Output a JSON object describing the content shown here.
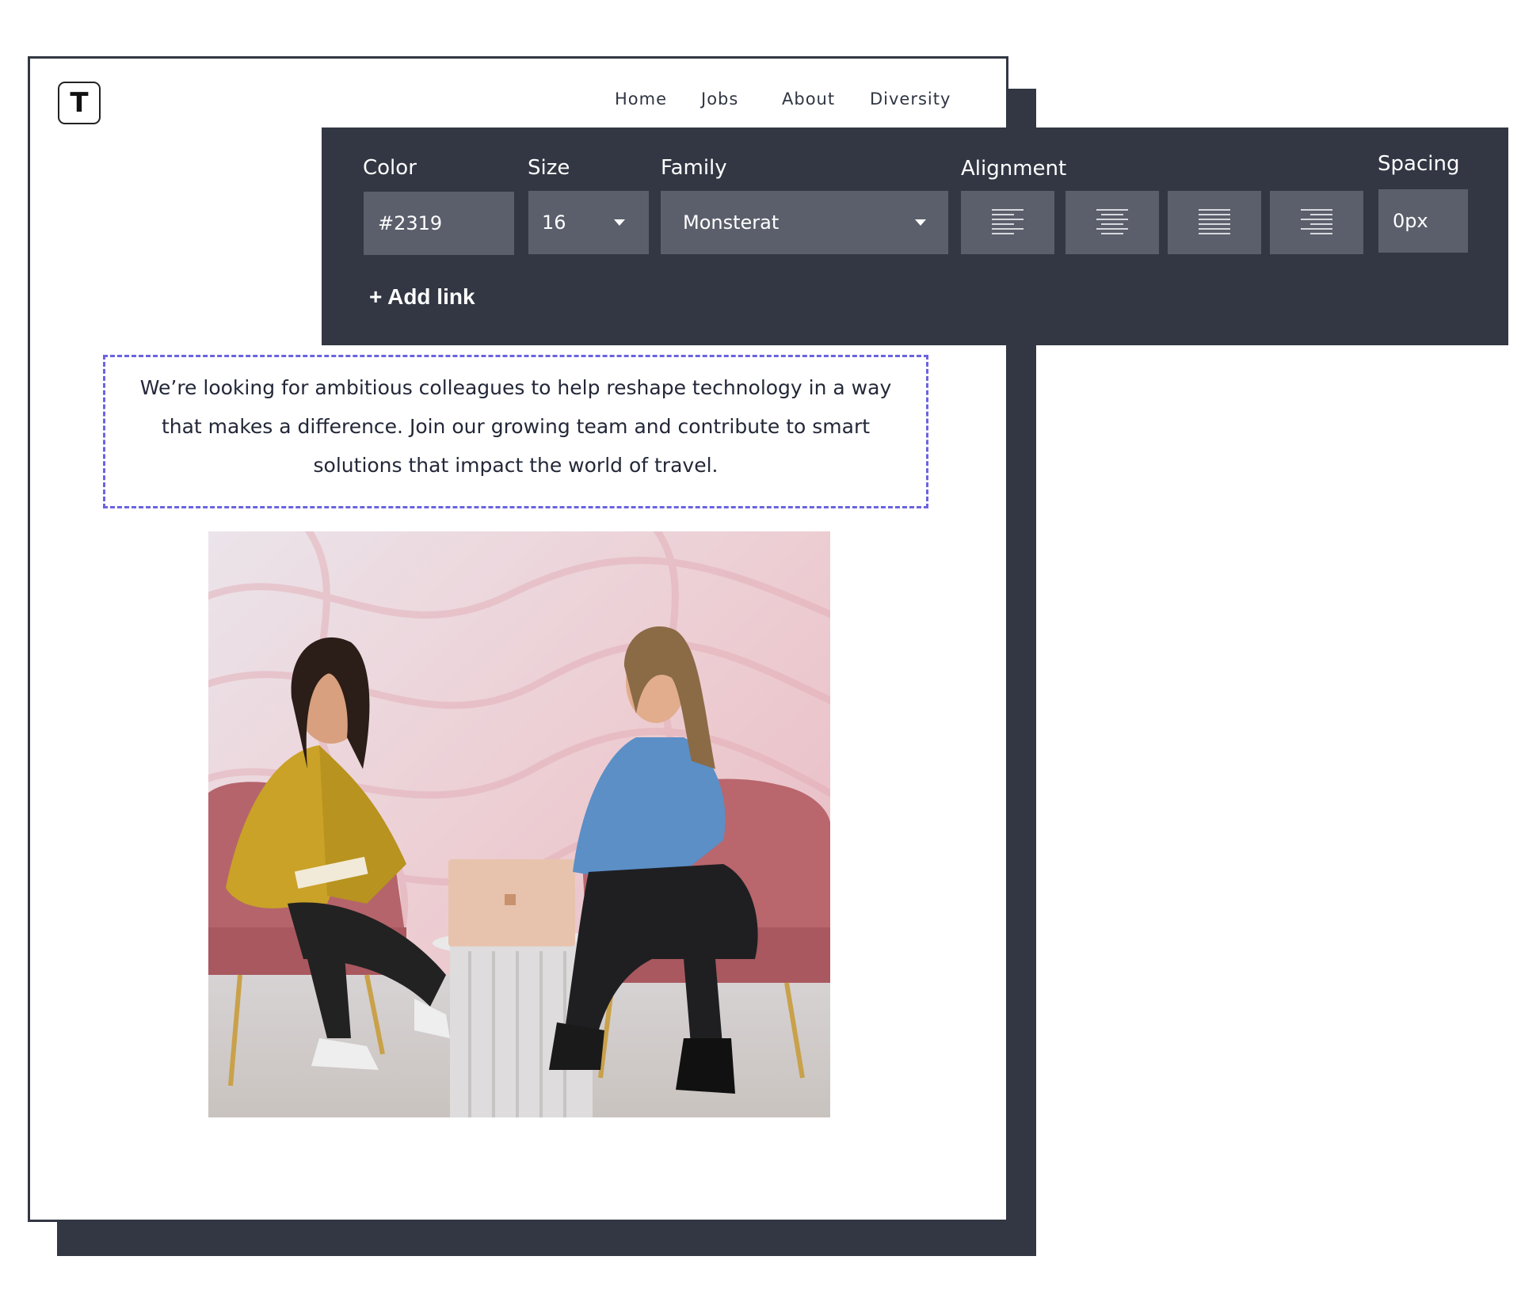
{
  "logo": {
    "letter": "T"
  },
  "nav": {
    "items": [
      "Home",
      "Jobs",
      "About",
      "Diversity"
    ]
  },
  "toolbar": {
    "color_label": "Color",
    "color_value": "#2319",
    "size_label": "Size",
    "size_value": "16",
    "family_label": "Family",
    "family_value": "Monsterat",
    "alignment_label": "Alignment",
    "alignment_options": [
      "align-left-icon",
      "align-center-icon",
      "align-justify-icon",
      "align-right-icon"
    ],
    "spacing_label": "Spacing",
    "spacing_value": "0px",
    "add_link_label": "+ Add link"
  },
  "content": {
    "paragraph": "We’re looking for ambitious colleagues to help reshape technology in a way that makes a difference. Join our growing team and contribute to smart solutions that impact the world of travel."
  },
  "colors": {
    "dark_panel": "#323743",
    "input_bg": "#5b5f6b",
    "dashed_border": "#6b63e0",
    "text": "#232838"
  }
}
